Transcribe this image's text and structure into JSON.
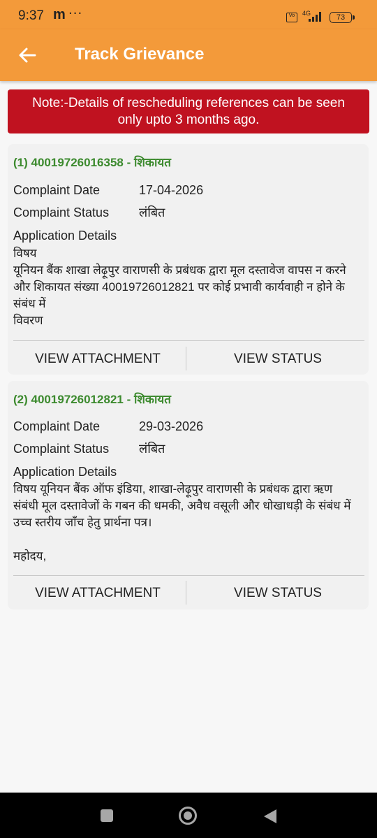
{
  "status_bar": {
    "time": "9:37",
    "carrier_icon": "m",
    "more": "···",
    "volte": "Vo",
    "network": "4G",
    "battery": "73"
  },
  "app_bar": {
    "title": "Track Grievance"
  },
  "note": {
    "line1": "Note:-Details of rescheduling references can be seen",
    "line2": "only upto 3 months ago."
  },
  "grievances": [
    {
      "heading": "(1) 40019726016358 - शिकायत",
      "date_label": "Complaint Date",
      "date": "17-04-2026",
      "status_label": "Complaint Status",
      "status": "लंबित",
      "details_label": "Application Details",
      "details_lines": [
        "विषय",
        "यूनियन बैंक शाखा लेढ़ूपुर वाराणसी के प्रबंधक द्वारा मूल दस्तावेज वापस न करने",
        "और शिकायत संख्या 40019726012821 पर कोई प्रभावी कार्यवाही न होने के",
        "संबंध में",
        "विवरण"
      ],
      "attachment_button": "VIEW ATTACHMENT",
      "status_button": "VIEW STATUS"
    },
    {
      "heading": "(2) 40019726012821 - शिकायत",
      "date_label": "Complaint Date",
      "date": "29-03-2026",
      "status_label": "Complaint Status",
      "status": "लंबित",
      "details_label": "Application Details",
      "details_lines": [
        "विषय  यूनियन बैंक ऑफ इंडिया, शाखा-लेढ़ूपुर वाराणसी के प्रबंधक द्वारा ऋण",
        "संबंधी मूल दस्तावेजों के गबन की धमकी, अवैध वसूली और धोखाधड़ी के संबंध में",
        "उच्च स्तरीय जाँच हेतु प्रार्थना पत्र।",
        "",
        "महोदय,"
      ],
      "attachment_button": "VIEW ATTACHMENT",
      "status_button": "VIEW STATUS"
    }
  ],
  "colors": {
    "app_bar": "#f39a3a",
    "note_bg": "#c01220",
    "heading": "#3c8a2e",
    "card_bg": "#f1f1f1"
  },
  "icons": {
    "back": "arrow-left-icon",
    "recents": "square-icon",
    "home": "circle-icon",
    "nav_back": "triangle-back-icon"
  }
}
